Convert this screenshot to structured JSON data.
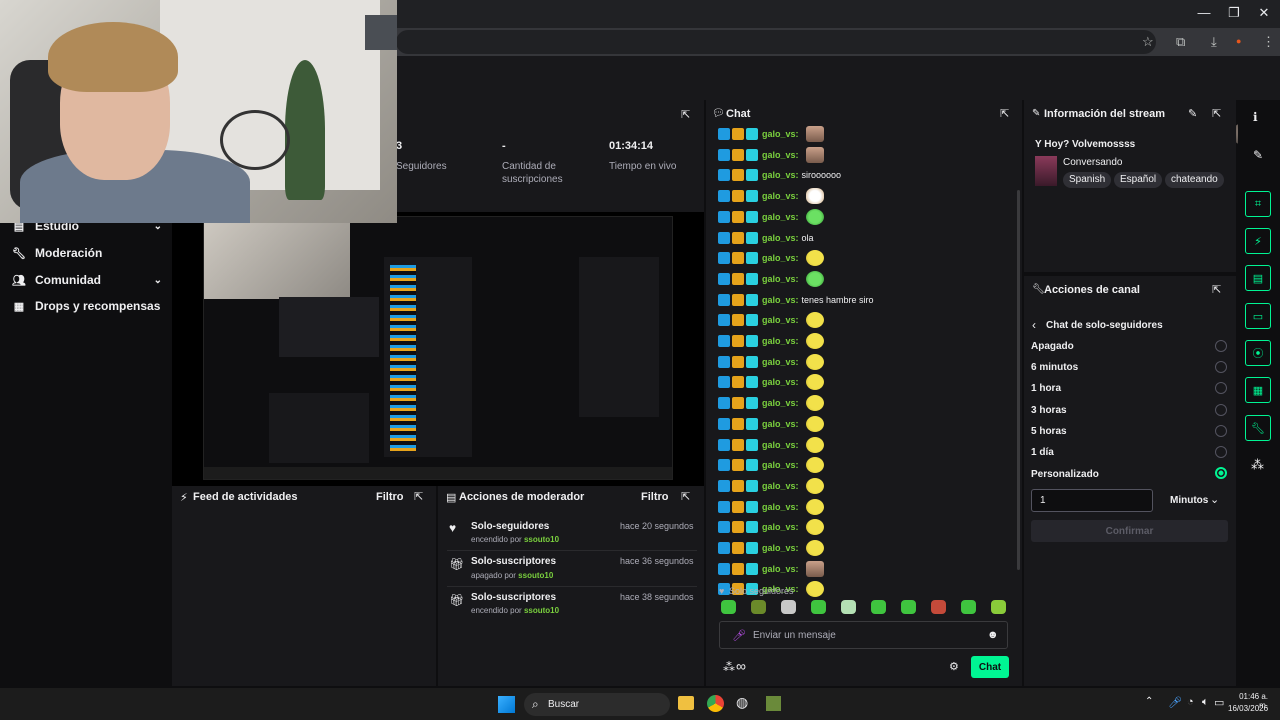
{
  "dashboard": {
    "stats": {
      "followers_value": "3",
      "followers_label": "Seguidores",
      "subs_value": "-",
      "subs_label_1": "Cantidad de",
      "subs_label_2": "suscripciones",
      "live_value": "01:34:14",
      "live_label": "Tiempo en vivo"
    },
    "nav": [
      {
        "label": "Estudio"
      },
      {
        "label": "Moderación"
      },
      {
        "label": "Comunidad"
      },
      {
        "label": "Drops y recompensas"
      }
    ]
  },
  "activity_feed": {
    "title": "Feed de actividades",
    "filter": "Filtro"
  },
  "mod_actions": {
    "title": "Acciones de moderador",
    "filter": "Filtro",
    "rows": [
      {
        "title": "Solo-seguidores",
        "status": "encendido por",
        "who": "ssouto10",
        "time": "hace 20 segundos",
        "icon": "heart-icon"
      },
      {
        "title": "Solo-suscriptores",
        "status": "apagado por",
        "who": "ssouto10",
        "time": "hace 36 segundos",
        "icon": "gift-icon"
      },
      {
        "title": "Solo-suscriptores",
        "status": "encendido por",
        "who": "ssouto10",
        "time": "hace 38 segundos",
        "icon": "gift-icon"
      }
    ]
  },
  "chat": {
    "title": "Chat",
    "messages": [
      {
        "user": "galo_vs:",
        "text": "",
        "emote": "photo"
      },
      {
        "user": "galo_vs:",
        "text": "",
        "emote": "photo"
      },
      {
        "user": "galo_vs:",
        "text": "siroooooo",
        "emote": ""
      },
      {
        "user": "galo_vs:",
        "text": "",
        "emote": "white"
      },
      {
        "user": "galo_vs:",
        "text": "",
        "emote": "green"
      },
      {
        "user": "galo_vs:",
        "text": "ola",
        "emote": ""
      },
      {
        "user": "galo_vs:",
        "text": "",
        "emote": "yellow"
      },
      {
        "user": "galo_vs:",
        "text": "",
        "emote": "green"
      },
      {
        "user": "galo_vs:",
        "text": "tenes hambre siro",
        "emote": ""
      },
      {
        "user": "galo_vs:",
        "text": "",
        "emote": "yellow"
      },
      {
        "user": "galo_vs:",
        "text": "",
        "emote": "yellow"
      },
      {
        "user": "galo_vs:",
        "text": "",
        "emote": "yellow"
      },
      {
        "user": "galo_vs:",
        "text": "",
        "emote": "yellow"
      },
      {
        "user": "galo_vs:",
        "text": "",
        "emote": "yellow"
      },
      {
        "user": "galo_vs:",
        "text": "",
        "emote": "yellow"
      },
      {
        "user": "galo_vs:",
        "text": "",
        "emote": "yellow"
      },
      {
        "user": "galo_vs:",
        "text": "",
        "emote": "yellow"
      },
      {
        "user": "galo_vs:",
        "text": "",
        "emote": "yellow"
      },
      {
        "user": "galo_vs:",
        "text": "",
        "emote": "yellow"
      },
      {
        "user": "galo_vs:",
        "text": "",
        "emote": "yellow"
      },
      {
        "user": "galo_vs:",
        "text": "",
        "emote": "yellow"
      },
      {
        "user": "galo_vs:",
        "text": "",
        "emote": "photo"
      },
      {
        "user": "galo_vs:",
        "text": "",
        "emote": "yellow"
      }
    ],
    "followers_only": "Solo seguidores",
    "input_placeholder": "Enviar un mensaje",
    "send_label": "Chat",
    "points_label": "∞"
  },
  "stream_info": {
    "title": "Información del stream",
    "stream_title": "Y Hoy? Volvemossss",
    "category": "Conversando",
    "tags": [
      "Spanish",
      "Español",
      "chateando"
    ]
  },
  "channel_actions": {
    "title": "Acciones de canal",
    "back_label": "Chat de solo-seguidores",
    "options": [
      {
        "label": "Apagado",
        "selected": false
      },
      {
        "label": "6 minutos",
        "selected": false
      },
      {
        "label": "1 hora",
        "selected": false
      },
      {
        "label": "3 horas",
        "selected": false
      },
      {
        "label": "5 horas",
        "selected": false
      },
      {
        "label": "1 día",
        "selected": false
      },
      {
        "label": "Personalizado",
        "selected": true
      }
    ],
    "custom_value": "1",
    "unit": "Minutos",
    "confirm": "Confirmar"
  },
  "taskbar": {
    "search": "Buscar",
    "time": "01:46 a. m.",
    "date": "16/03/2026"
  }
}
